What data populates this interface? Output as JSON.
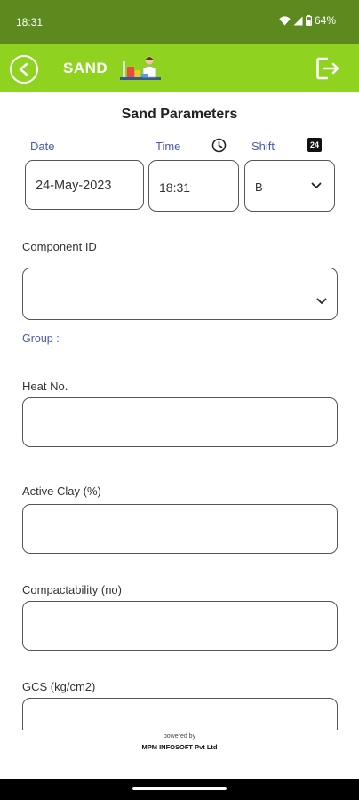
{
  "status": {
    "time": "18:31",
    "battery": "64%"
  },
  "app_bar": {
    "title": "SAND"
  },
  "page": {
    "title": "Sand Parameters"
  },
  "form": {
    "date_label": "Date",
    "time_label": "Time",
    "shift_label": "Shift",
    "date_value": "24-May-2023",
    "time_value": "18:31",
    "shift_value": "B",
    "component_label": "Component ID",
    "component_value": "",
    "group_label": "Group :",
    "heat_label": "Heat No.",
    "heat_value": "",
    "clay_label": "Active Clay (%)",
    "clay_value": "",
    "compact_label": "Compactability (no)",
    "compact_value": "",
    "gcs_label": "GCS (kg/cm2)",
    "gcs_value": ""
  },
  "footer": {
    "powered": "powered by",
    "company": "MPM INFOSOFT Pvt Ltd"
  },
  "icons": {
    "back": "back-arrow-icon",
    "logout": "logout-icon",
    "clock": "clock-icon",
    "format24": "24-hour-icon",
    "dropdown": "chevron-down-icon"
  },
  "colors": {
    "status_bar": "#5c8a1e",
    "app_bar": "#8fd320",
    "label_blue": "#4a5aa8"
  }
}
